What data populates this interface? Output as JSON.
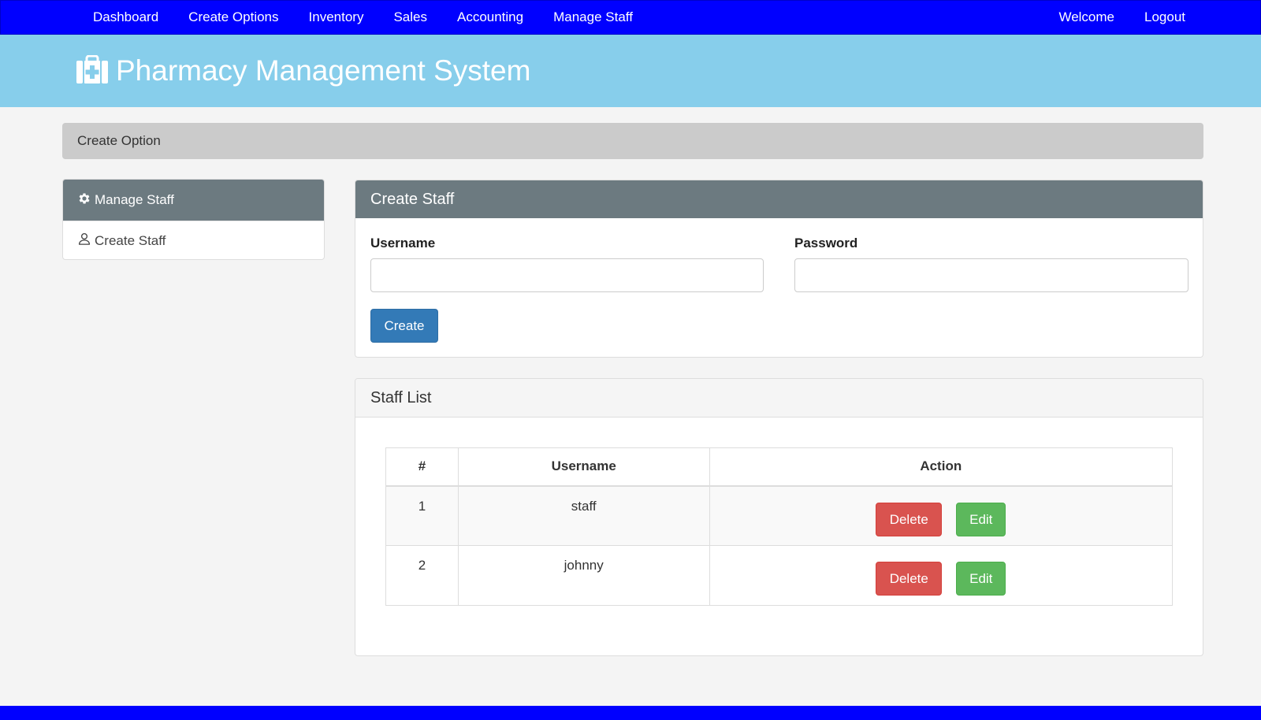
{
  "nav": {
    "left": [
      "Dashboard",
      "Create Options",
      "Inventory",
      "Sales",
      "Accounting",
      "Manage Staff"
    ],
    "right": [
      "Welcome",
      "Logout"
    ]
  },
  "header": {
    "title": "Pharmacy Management System",
    "icon": "medkit-icon"
  },
  "breadcrumb": "Create Option",
  "sidebar": {
    "heading": "Manage Staff",
    "items": [
      {
        "label": "Create Staff",
        "icon": "user-icon"
      }
    ]
  },
  "create_form": {
    "title": "Create Staff",
    "username_label": "Username",
    "username_value": "",
    "password_label": "Password",
    "password_value": "",
    "submit_label": "Create"
  },
  "staff_list": {
    "title": "Staff List",
    "columns": [
      "#",
      "Username",
      "Action"
    ],
    "rows": [
      {
        "num": "1",
        "username": "staff",
        "delete_label": "Delete",
        "edit_label": "Edit"
      },
      {
        "num": "2",
        "username": "johnny",
        "delete_label": "Delete",
        "edit_label": "Edit"
      }
    ]
  },
  "colors": {
    "nav_bg": "#0000ff",
    "hero_bg": "#87ceeb",
    "panel_head": "#6c7a80",
    "primary": "#337ab7",
    "danger": "#d9534f",
    "success": "#5cb85c"
  }
}
